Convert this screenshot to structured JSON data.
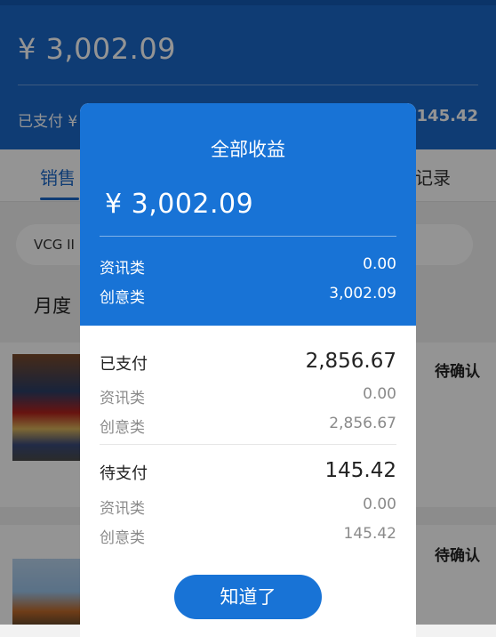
{
  "background": {
    "header": {
      "amount": "¥ 3,002.09",
      "paid_label": "已支付 ¥",
      "pending_amount": "145.42"
    },
    "tabs": {
      "left": "销售",
      "right": "记录"
    },
    "filter": {
      "text": "VCG II"
    },
    "period_label": "月度",
    "cards": [
      {
        "status": "待确认"
      },
      {
        "status": "待确认"
      }
    ]
  },
  "modal": {
    "title": "全部收益",
    "total": "¥ 3,002.09",
    "breakdown": [
      {
        "label": "资讯类",
        "value": "0.00"
      },
      {
        "label": "创意类",
        "value": "3,002.09"
      }
    ],
    "paid": {
      "label": "已支付",
      "value": "2,856.67",
      "items": [
        {
          "label": "资讯类",
          "value": "0.00"
        },
        {
          "label": "创意类",
          "value": "2,856.67"
        }
      ]
    },
    "pending": {
      "label": "待支付",
      "value": "145.42",
      "items": [
        {
          "label": "资讯类",
          "value": "0.00"
        },
        {
          "label": "创意类",
          "value": "145.42"
        }
      ]
    },
    "confirm_button": "知道了"
  },
  "colors": {
    "header_blue": "#1a68c8",
    "modal_blue": "#1873d6",
    "overlay": "rgba(0,0,0,0.42)"
  }
}
